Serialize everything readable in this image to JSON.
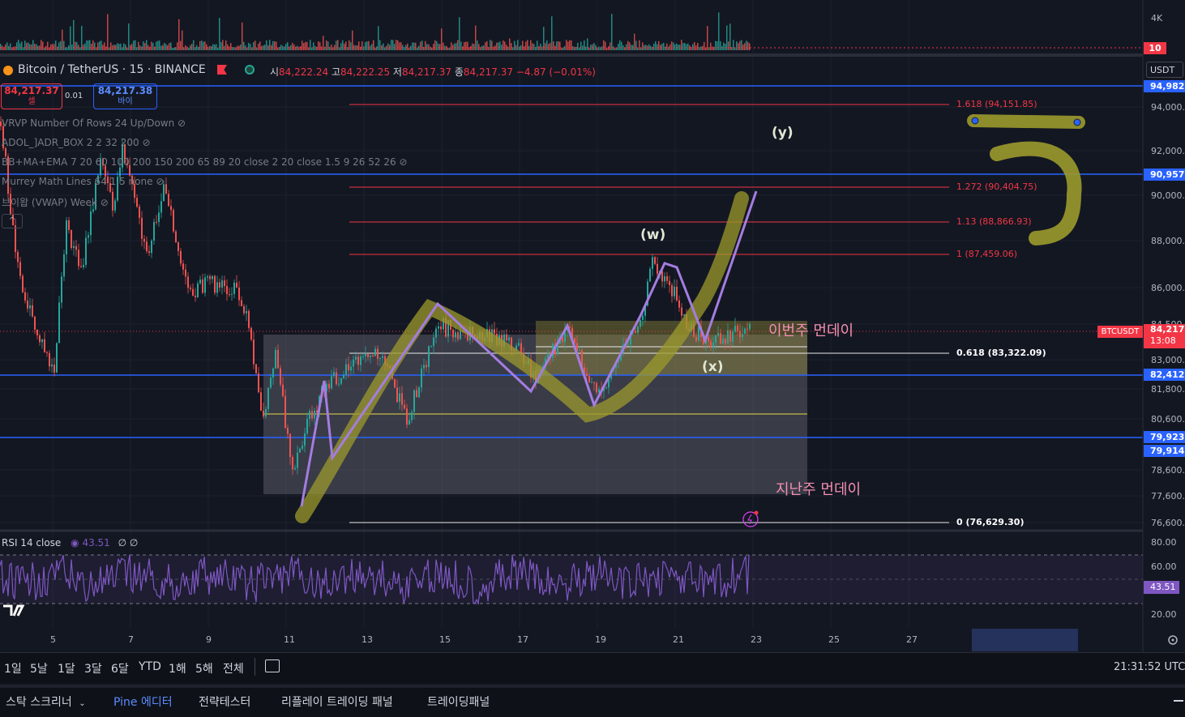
{
  "header": {
    "symbol": "Bitcoin / TetherUS · 15 · BINANCE",
    "ohlc_o_label": "시",
    "ohlc_o": "84,222.24",
    "ohlc_h_label": "고",
    "ohlc_h": "84,222.25",
    "ohlc_l_label": "저",
    "ohlc_l": "84,217.37",
    "ohlc_c_label": "종",
    "ohlc_c": "84,217.37",
    "change": "−4.87 (−0.01%)"
  },
  "trade": {
    "sell_price": "84,217.37",
    "sell_label": "셀",
    "spread": "0.01",
    "buy_price": "84,217.38",
    "buy_label": "바이"
  },
  "indicators": [
    "VRVP Number Of Rows 24 Up/Down",
    "ADOL_]ADR_BOX 2 2 32 200",
    "BB+MA+EMA 7 20 60 100 200 150 200 65 89 20 close 2 20 close 1.5 9 26 52 26",
    "Murrey Math Lines 64 1.5 none",
    "브이왑 (VWAP) Week"
  ],
  "price_axis": {
    "currency": "USDT",
    "labels": [
      "94,000.0",
      "92,000.0",
      "90,000.0",
      "88,000.0",
      "86,000.0",
      "84,500",
      "83,000.0",
      "81,800.0",
      "80,600.0",
      "78,600.0",
      "77,600.0",
      "76,600.0"
    ],
    "highlight_blue": [
      "94,982.",
      "90,957.",
      "82,412.",
      "79,923.",
      "79,914."
    ],
    "symbol_tag": "BTCUSDT",
    "current_price": "84,217.",
    "countdown": "13:08",
    "volume_4k": "4K",
    "volume_10": "10"
  },
  "fib_levels": [
    {
      "label": "1.618 (94,151.85)"
    },
    {
      "label": "1.272 (90,404.75)"
    },
    {
      "label": "1.13 (88,866.93)"
    },
    {
      "label": "1 (87,459.06)"
    },
    {
      "label": "0.618 (83,322.09)"
    },
    {
      "label": "0 (76,629.30)"
    }
  ],
  "annotations": {
    "w": "(w)",
    "x": "(x)",
    "y": "(y)",
    "this_week": "이번주 먼데이",
    "last_week": "지난주 먼데이"
  },
  "rsi": {
    "label": "RSI 14 close",
    "value": "43.51",
    "extra": "∅ ∅",
    "axis": [
      "80.00",
      "60.00",
      "20.00"
    ]
  },
  "time_axis": [
    "5",
    "7",
    "9",
    "11",
    "13",
    "15",
    "17",
    "19",
    "21",
    "23",
    "25",
    "27"
  ],
  "timeframes": [
    "1일",
    "5날",
    "1달",
    "3달",
    "6달",
    "YTD",
    "1해",
    "5해",
    "전체"
  ],
  "clock": "21:31:52 UTC+",
  "bottom_tabs": [
    "스탁 스크리너",
    "Pine 에디터",
    "전략테스터",
    "리플레이 트레이딩 패널",
    "트레이딩패널"
  ],
  "colors": {
    "bg": "#131722",
    "up": "#26a69a",
    "down": "#ef5350",
    "blue": "#2962ff",
    "fib": "#f23645",
    "highlighter": "#9c9a2c",
    "wave": "#9c6ad6",
    "rsi": "#7e57c2"
  }
}
